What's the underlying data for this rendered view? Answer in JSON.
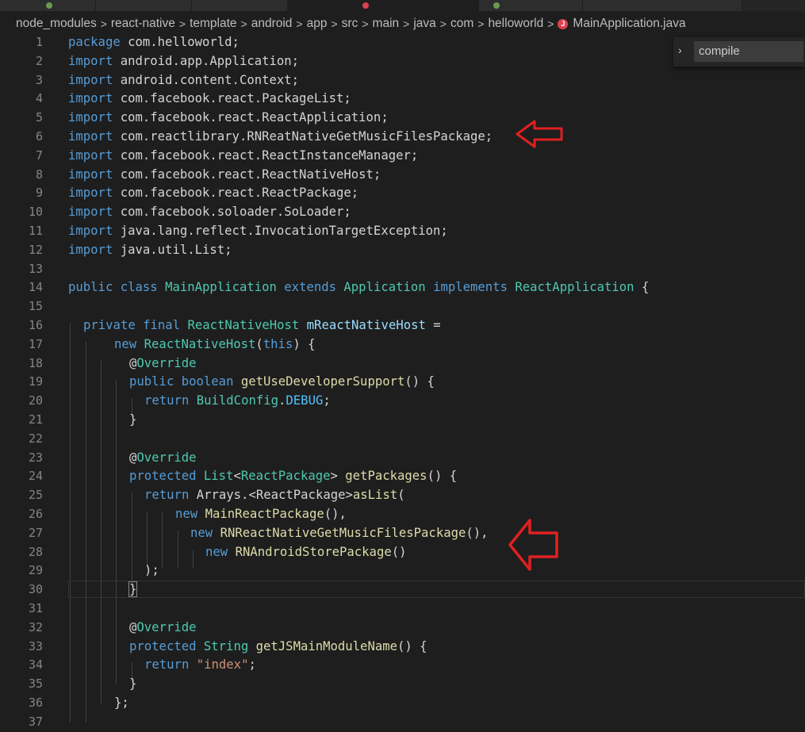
{
  "breadcrumb": [
    "node_modules",
    "react-native",
    "template",
    "android",
    "app",
    "src",
    "main",
    "java",
    "com",
    "helloworld"
  ],
  "file_name": "MainApplication.java",
  "file_icon_letter": "J",
  "find_widget": {
    "value": "compile"
  },
  "line_numbers": [
    "1",
    "2",
    "3",
    "4",
    "5",
    "6",
    "7",
    "8",
    "9",
    "10",
    "11",
    "12",
    "13",
    "14",
    "15",
    "16",
    "17",
    "18",
    "19",
    "20",
    "21",
    "22",
    "23",
    "24",
    "25",
    "26",
    "27",
    "28",
    "29",
    "30",
    "31",
    "32",
    "33",
    "34",
    "35",
    "36",
    "37"
  ],
  "code": {
    "l1": [
      "package",
      " com.helloworld;"
    ],
    "l2": [
      "import",
      " android.app.Application;"
    ],
    "l3": [
      "import",
      " android.content.Context;"
    ],
    "l4": [
      "import",
      " com.facebook.react.PackageList;"
    ],
    "l5": [
      "import",
      " com.facebook.react.ReactApplication;"
    ],
    "l6": [
      "import",
      " com.reactlibrary.RNReatNativeGetMusicFilesPackage;"
    ],
    "l7": [
      "import",
      " com.facebook.react.ReactInstanceManager;"
    ],
    "l8": [
      "import",
      " com.facebook.react.ReactNativeHost;"
    ],
    "l9": [
      "import",
      " com.facebook.react.ReactPackage;"
    ],
    "l10": [
      "import",
      " com.facebook.soloader.SoLoader;"
    ],
    "l11": [
      "import",
      " java.lang.reflect.InvocationTargetException;"
    ],
    "l12": [
      "import",
      " java.util.List;"
    ],
    "l14": [
      "public",
      " ",
      "class",
      " ",
      "MainApplication",
      " ",
      "extends",
      " ",
      "Application",
      " ",
      "implements",
      " ",
      "ReactApplication",
      " {"
    ],
    "l16": [
      "private",
      " ",
      "final",
      " ",
      "ReactNativeHost",
      " ",
      "mReactNativeHost",
      " ="
    ],
    "l17": [
      "new",
      " ",
      "ReactNativeHost",
      "(",
      "this",
      ") {"
    ],
    "l18": [
      "@",
      "Override"
    ],
    "l19": [
      "public",
      " ",
      "boolean",
      " ",
      "getUseDeveloperSupport",
      "() {"
    ],
    "l20": [
      "return",
      " ",
      "BuildConfig",
      ".",
      "DEBUG",
      ";"
    ],
    "l21": [
      "}"
    ],
    "l23": [
      "@",
      "Override"
    ],
    "l24": [
      "protected",
      " ",
      "List",
      "<",
      "ReactPackage",
      "> ",
      "getPackages",
      "() {"
    ],
    "l25": [
      "return",
      " Arrays.<ReactPackage>",
      "asList",
      "("
    ],
    "l26": [
      "new",
      " ",
      "MainReactPackage",
      "(),"
    ],
    "l27": [
      "new",
      " ",
      "RNReactNativeGetMusicFilesPackage",
      "(),"
    ],
    "l28": [
      "new",
      " ",
      "RNAndroidStorePackage",
      "()"
    ],
    "l29": [
      ");"
    ],
    "l30": [
      "}"
    ],
    "l32": [
      "@",
      "Override"
    ],
    "l33": [
      "protected",
      " ",
      "String",
      " ",
      "getJSMainModuleName",
      "() {"
    ],
    "l34": [
      "return",
      " ",
      "\"index\"",
      ";"
    ],
    "l35": [
      "}"
    ],
    "l36": [
      "};"
    ]
  },
  "colors": {
    "keyword": "#569cd6",
    "type": "#4ec9b0",
    "function": "#dcdcaa",
    "variable": "#9cdcfe",
    "string": "#ce9178",
    "constant": "#4fc1ff",
    "annotation_arrow": "#e02020"
  }
}
